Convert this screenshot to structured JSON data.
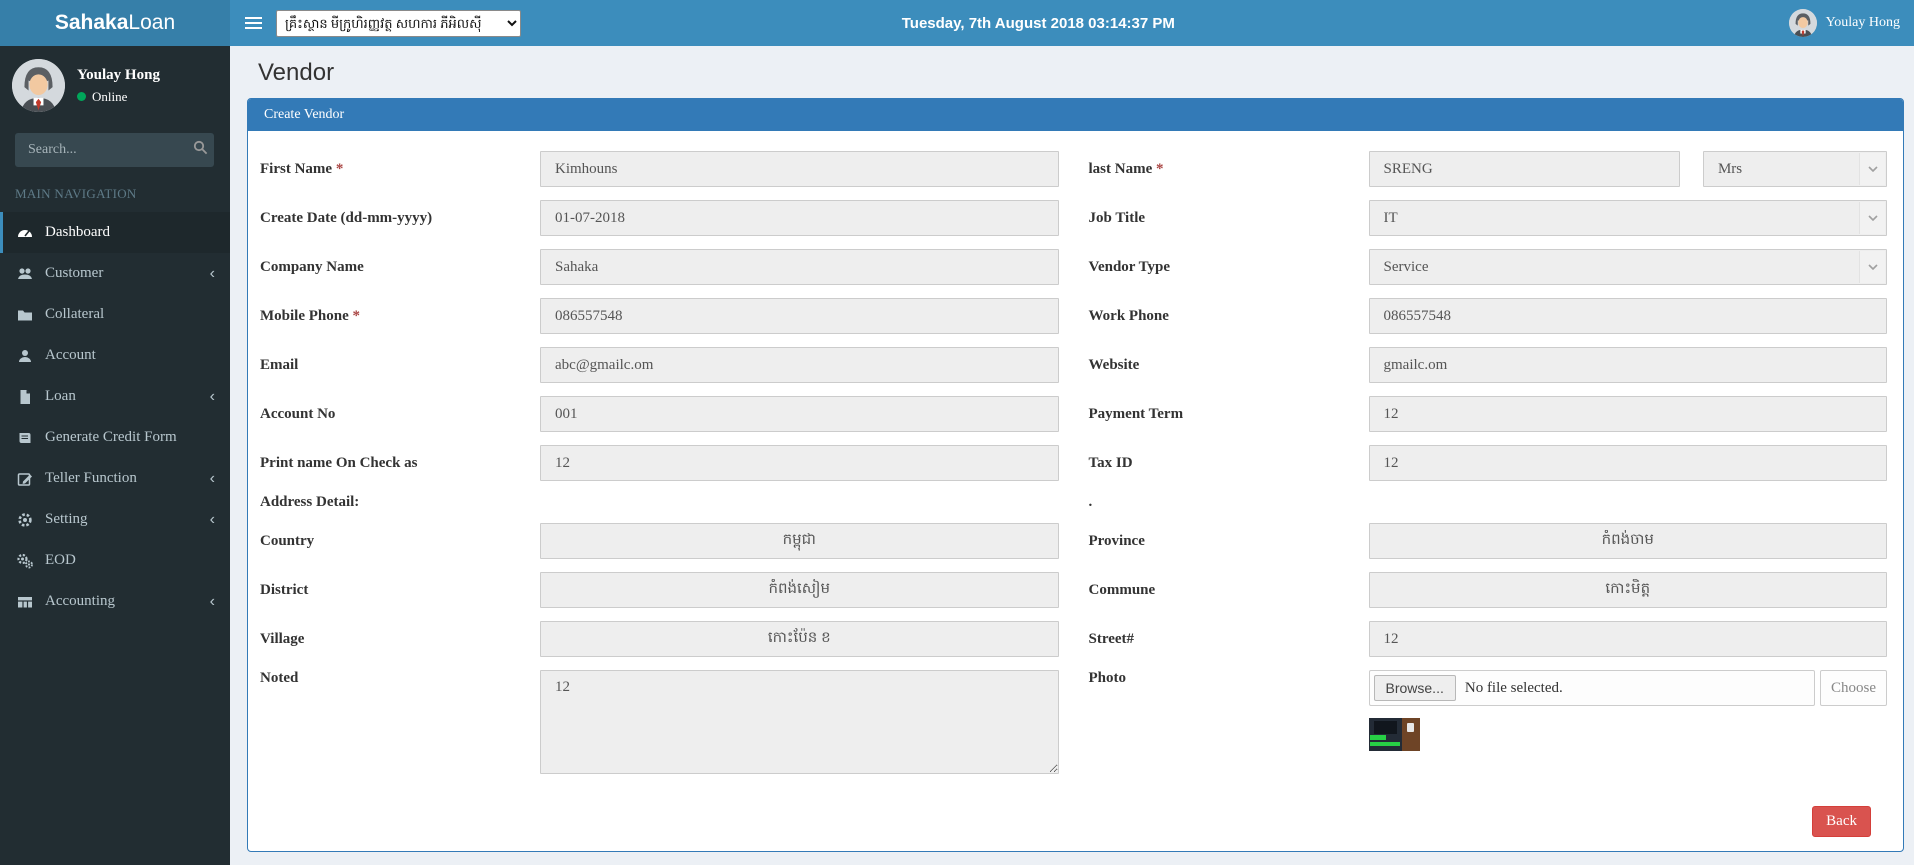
{
  "colors": {
    "accent": "#3c8dbc",
    "logo_bg": "#367fa9",
    "panel_header": "#337ab7",
    "sidebar_bg": "#222d32",
    "danger": "#d9534f",
    "online_green": "#00a65a",
    "input_bg": "#eeeeee"
  },
  "header": {
    "brand_bold": "Sahaka",
    "brand_light": "Loan",
    "menu_icon": "hamburger-icon",
    "branch_selected": "គ្រឹះស្ថាន មីក្រូហិរញ្ញវត្ថុ សហការ ភីអិលស៊ី",
    "datetime": "Tuesday, 7th August 2018 03:14:37 PM",
    "user_name": "Youlay Hong"
  },
  "sidebar": {
    "user": {
      "name": "Youlay Hong",
      "status": "Online"
    },
    "search_placeholder": "Search...",
    "nav_header": "MAIN NAVIGATION",
    "items": [
      {
        "label": "Dashboard",
        "icon": "dashboard-icon",
        "active": true,
        "chevron": false
      },
      {
        "label": "Customer",
        "icon": "users-icon",
        "active": false,
        "chevron": true
      },
      {
        "label": "Collateral",
        "icon": "folder-icon",
        "active": false,
        "chevron": false
      },
      {
        "label": "Account",
        "icon": "user-icon",
        "active": false,
        "chevron": false
      },
      {
        "label": "Loan",
        "icon": "file-icon",
        "active": false,
        "chevron": true
      },
      {
        "label": "Generate Credit Form",
        "icon": "book-icon",
        "active": false,
        "chevron": false
      },
      {
        "label": "Teller Function",
        "icon": "edit-icon",
        "active": false,
        "chevron": true
      },
      {
        "label": "Setting",
        "icon": "gear-icon",
        "active": false,
        "chevron": true
      },
      {
        "label": "EOD",
        "icon": "gears-icon",
        "active": false,
        "chevron": false
      },
      {
        "label": "Accounting",
        "icon": "table-icon",
        "active": false,
        "chevron": true
      }
    ],
    "chevron_glyph": "‹"
  },
  "page": {
    "title": "Vendor",
    "panel_title": "Create Vendor"
  },
  "form": {
    "required_mark": "*",
    "fields": {
      "first_name": {
        "label": "First Name",
        "value": "Kimhouns"
      },
      "last_name": {
        "label": "last Name",
        "value": "SRENG"
      },
      "title_select": {
        "value": "Mrs"
      },
      "create_date": {
        "label": "Create Date (dd-mm-yyyy)",
        "value": "01-07-2018"
      },
      "job_title": {
        "label": "Job Title",
        "value": "IT"
      },
      "company_name": {
        "label": "Company Name",
        "value": "Sahaka"
      },
      "vendor_type": {
        "label": "Vendor Type",
        "value": "Service"
      },
      "mobile_phone": {
        "label": "Mobile Phone",
        "value": "086557548"
      },
      "work_phone": {
        "label": "Work Phone",
        "value": "086557548"
      },
      "email": {
        "label": "Email",
        "value": "abc@gmailc.om"
      },
      "website": {
        "label": "Website",
        "value": "gmailc.om"
      },
      "account_no": {
        "label": "Account No",
        "value": "001"
      },
      "payment_term": {
        "label": "Payment Term",
        "value": "12"
      },
      "print_name": {
        "label": "Print name On Check as",
        "value": "12"
      },
      "tax_id": {
        "label": "Tax ID",
        "value": "12"
      },
      "address_detail_left": {
        "label": "Address Detail:"
      },
      "address_detail_right": {
        "label": "."
      },
      "country": {
        "label": "Country",
        "value": "កម្ពុជា"
      },
      "province": {
        "label": "Province",
        "value": "កំពង់ចាម"
      },
      "district": {
        "label": "District",
        "value": "កំពង់សៀម"
      },
      "commune": {
        "label": "Commune",
        "value": "កោះមិត្ត"
      },
      "village": {
        "label": "Village",
        "value": "កោះប៉ែន ខ"
      },
      "street": {
        "label": "Street#",
        "value": "12"
      },
      "noted": {
        "label": "Noted",
        "value": "12"
      },
      "photo": {
        "label": "Photo",
        "browse_label": "Browse...",
        "status": "No file selected.",
        "choose_label": "Choose",
        "thumbnail": "photo-thumbnail"
      }
    },
    "back_button": "Back"
  }
}
